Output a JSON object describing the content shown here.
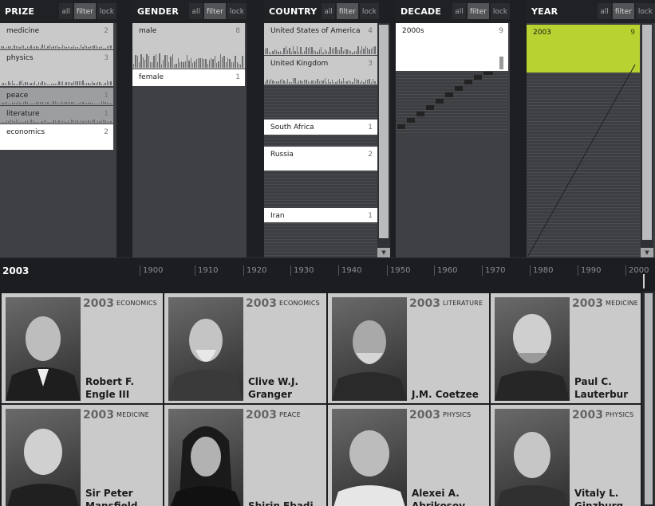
{
  "buttons": {
    "all": "all",
    "filter": "filter",
    "lock": "lock"
  },
  "panels": {
    "prize": {
      "title": "PRIZE",
      "items": [
        {
          "label": "medicine",
          "count": "2"
        },
        {
          "label": "physics",
          "count": "3"
        },
        {
          "label": "peace",
          "count": "1"
        },
        {
          "label": "literature",
          "count": "1"
        },
        {
          "label": "economics",
          "count": "2"
        }
      ]
    },
    "gender": {
      "title": "GENDER",
      "items": [
        {
          "label": "male",
          "count": "8"
        },
        {
          "label": "female",
          "count": "1"
        }
      ]
    },
    "country": {
      "title": "COUNTRY",
      "items": [
        {
          "label": "United States of America",
          "count": "4"
        },
        {
          "label": "United Kingdom",
          "count": "3"
        },
        {
          "label": "South Africa",
          "count": "1"
        },
        {
          "label": "Russia",
          "count": "2"
        },
        {
          "label": "Iran",
          "count": "1"
        }
      ]
    },
    "decade": {
      "title": "DECADE",
      "items": [
        {
          "label": "2000s",
          "count": "9"
        }
      ]
    },
    "year": {
      "title": "YEAR",
      "items": [
        {
          "label": "2003",
          "count": "9"
        }
      ]
    }
  },
  "timeline": {
    "current": "2003",
    "ticks": [
      "1900",
      "1910",
      "1920",
      "1930",
      "1940",
      "1950",
      "1960",
      "1970",
      "1980",
      "1990",
      "2000"
    ]
  },
  "laureates": [
    {
      "year": "2003",
      "prize": "ECONOMICS",
      "name1": "Robert F.",
      "name2": "Engle III"
    },
    {
      "year": "2003",
      "prize": "ECONOMICS",
      "name1": "Clive W.J.",
      "name2": "Granger"
    },
    {
      "year": "2003",
      "prize": "LITERATURE",
      "name1": "J.M. Coetzee",
      "name2": ""
    },
    {
      "year": "2003",
      "prize": "MEDICINE",
      "name1": "Paul C.",
      "name2": "Lauterbur"
    },
    {
      "year": "2003",
      "prize": "MEDICINE",
      "name1": "Sir Peter",
      "name2": "Mansfield"
    },
    {
      "year": "2003",
      "prize": "PEACE",
      "name1": "Shirin Ebadi",
      "name2": ""
    },
    {
      "year": "2003",
      "prize": "PHYSICS",
      "name1": "Alexei A.",
      "name2": "Abrikosov"
    },
    {
      "year": "2003",
      "prize": "PHYSICS",
      "name1": "Vitaly L.",
      "name2": "Ginzburg"
    }
  ],
  "colors": {
    "accent": "#b7d231",
    "panel": "#3e4043",
    "card": "#cacaca",
    "background": "#1d1f22"
  }
}
